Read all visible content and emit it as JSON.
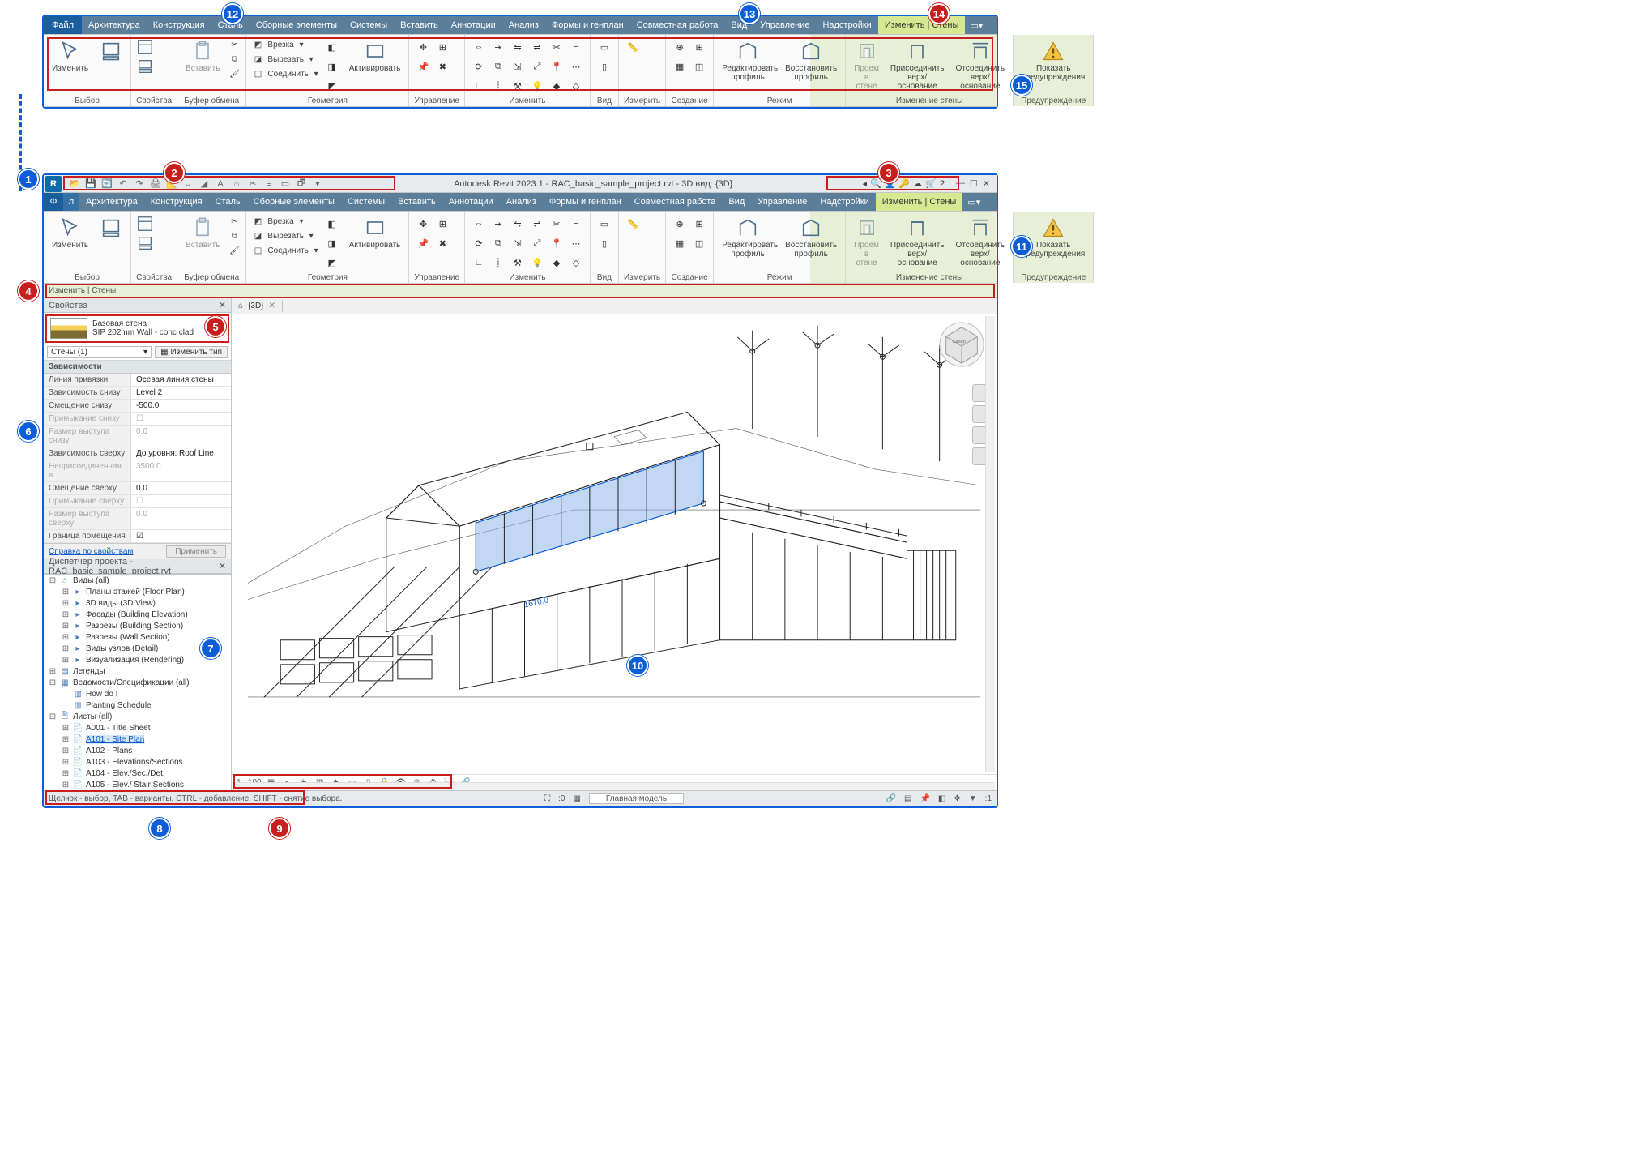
{
  "titlebar": {
    "title_center": "Autodesk Revit 2023.1 - RAC_basic_sample_project.rvt - 3D вид: {3D}"
  },
  "tabs": {
    "file": "Файл",
    "list": [
      "Архитектура",
      "Конструкция",
      "Сталь",
      "Сборные элементы",
      "Системы",
      "Вставить",
      "Аннотации",
      "Анализ",
      "Формы и генплан",
      "Совместная работа",
      "Вид",
      "Управление",
      "Надстройки"
    ],
    "contextual": "Изменить | Стены"
  },
  "ribbon": {
    "select": {
      "modify": "Изменить",
      "title": "Выбор"
    },
    "props": {
      "title": "Свойства"
    },
    "clipboard": {
      "paste": "Вставить",
      "title": "Буфер обмена"
    },
    "geometry": {
      "vrezka": "Врезка",
      "cut": "Вырезать",
      "join": "Соединить",
      "activate": "Активировать",
      "title": "Геометрия"
    },
    "manage": {
      "title": "Управление"
    },
    "modifygrp": {
      "title": "Изменить"
    },
    "view": {
      "title": "Вид"
    },
    "measure": {
      "title": "Измерить"
    },
    "create": {
      "title": "Создание"
    },
    "mode": {
      "edit_profile": "Редактировать профиль",
      "restore_profile": "Восстановить профиль",
      "title": "Режим"
    },
    "wallmod": {
      "opening": "Проем в стене",
      "attach": "Присоединить верх/основание",
      "detach": "Отсоединить верх/основание",
      "title": "Изменение стены"
    },
    "warn": {
      "show": "Показать предупреждения",
      "title": "Предупреждение"
    }
  },
  "context_bar": "Изменить | Стены",
  "properties": {
    "panel_title": "Свойства",
    "type_line1": "Базовая стена",
    "type_line2": "SIP 202mm Wall - conc clad",
    "filter": "Стены (1)",
    "edit_type": "Изменить тип",
    "cat_constraints": "Зависимости",
    "rows": [
      {
        "k": "Линия привязки",
        "v": "Осевая линия стены"
      },
      {
        "k": "Зависимость снизу",
        "v": "Level 2"
      },
      {
        "k": "Смещение снизу",
        "v": "-500.0"
      },
      {
        "k": "Примыкание снизу",
        "v": "",
        "dim": true,
        "chk": false
      },
      {
        "k": "Размер выступа снизу",
        "v": "0.0",
        "dim": true
      },
      {
        "k": "Зависимость сверху",
        "v": "До уровня: Roof Line"
      },
      {
        "k": "Неприсоединенная в...",
        "v": "3500.0",
        "dim": true
      },
      {
        "k": "Смещение сверху",
        "v": "0.0"
      },
      {
        "k": "Примыкание сверху",
        "v": "",
        "dim": true,
        "chk": false
      },
      {
        "k": "Размер выступа сверху",
        "v": "0.0",
        "dim": true
      },
      {
        "k": "Граница помещения",
        "v": "",
        "chk": true
      }
    ],
    "help_link": "Справка по свойствам",
    "apply": "Применить"
  },
  "browser": {
    "title": "Диспетчер проекта - RAC_basic_sample_project.rvt",
    "nodes": [
      {
        "d": 0,
        "e": "-",
        "i": "home",
        "t": "Виды (all)"
      },
      {
        "d": 1,
        "e": "+",
        "i": "fld",
        "t": "Планы этажей (Floor Plan)"
      },
      {
        "d": 1,
        "e": "+",
        "i": "fld",
        "t": "3D виды (3D View)"
      },
      {
        "d": 1,
        "e": "+",
        "i": "fld",
        "t": "Фасады (Building Elevation)"
      },
      {
        "d": 1,
        "e": "+",
        "i": "fld",
        "t": "Разрезы (Building Section)"
      },
      {
        "d": 1,
        "e": "+",
        "i": "fld",
        "t": "Разрезы (Wall Section)"
      },
      {
        "d": 1,
        "e": "+",
        "i": "fld",
        "t": "Виды узлов (Detail)"
      },
      {
        "d": 1,
        "e": "+",
        "i": "fld",
        "t": "Визуализация (Rendering)"
      },
      {
        "d": 0,
        "e": "+",
        "i": "leg",
        "t": "Легенды"
      },
      {
        "d": 0,
        "e": "-",
        "i": "sch",
        "t": "Ведомости/Спецификации (all)"
      },
      {
        "d": 1,
        "e": "",
        "i": "tbl",
        "t": "How do I"
      },
      {
        "d": 1,
        "e": "",
        "i": "tbl",
        "t": "Planting Schedule"
      },
      {
        "d": 0,
        "e": "-",
        "i": "sht",
        "t": "Листы (all)"
      },
      {
        "d": 1,
        "e": "+",
        "i": "pg",
        "t": "A001 - Title Sheet"
      },
      {
        "d": 1,
        "e": "+",
        "i": "pg",
        "t": "A101 - Site Plan",
        "sel": true
      },
      {
        "d": 1,
        "e": "+",
        "i": "pg",
        "t": "A102 - Plans"
      },
      {
        "d": 1,
        "e": "+",
        "i": "pg",
        "t": "A103 - Elevations/Sections"
      },
      {
        "d": 1,
        "e": "+",
        "i": "pg",
        "t": "A104 - Elev./Sec./Det."
      },
      {
        "d": 1,
        "e": "+",
        "i": "pg",
        "t": "A105 - Elev./ Stair Sections"
      }
    ]
  },
  "viewtab": {
    "name": "{3D}"
  },
  "viewctrl": {
    "scale": "1 : 100"
  },
  "status": {
    "hint": "Щелчок - выбор, TAB - варианты, CTRL - добавление, SHIFT - снятие выбора.",
    "sel_count": ":0",
    "model": "Главная модель"
  },
  "callouts": {
    "1": "1",
    "2": "2",
    "3": "3",
    "4": "4",
    "5": "5",
    "6": "6",
    "7": "7",
    "8": "8",
    "9": "9",
    "10": "10",
    "11": "11",
    "12": "12",
    "13": "13",
    "14": "14",
    "15": "15"
  }
}
